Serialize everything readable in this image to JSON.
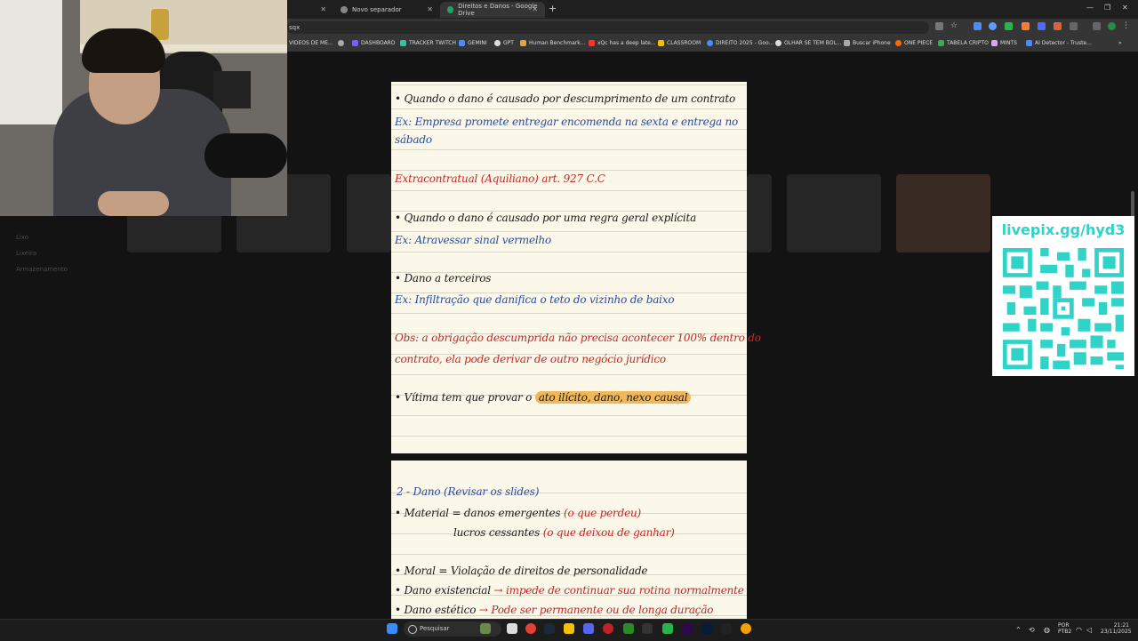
{
  "browser": {
    "tabs": [
      {
        "label": "",
        "active": false
      },
      {
        "label": "Novo separador",
        "active": false
      },
      {
        "label": "Direitos e Danos - Google Drive",
        "active": true
      }
    ],
    "address": "sqx",
    "bookmarks": [
      {
        "label": "VIDEOS DE ME...",
        "color": "#888888"
      },
      {
        "label": "DASHBOARD",
        "color": "#7b5cff"
      },
      {
        "label": "TRACKER TWITCH",
        "color": "#3ac0a0"
      },
      {
        "label": "GEMINI",
        "color": "#4a8cff"
      },
      {
        "label": "GPT",
        "color": "#dddddd"
      },
      {
        "label": "Human Benchmark...",
        "color": "#e6a23c"
      },
      {
        "label": "xQc has a deep late...",
        "color": "#ff3333"
      },
      {
        "label": "CLASSROOM",
        "color": "#f2c200"
      },
      {
        "label": "DIREITO 2025 - Goo...",
        "color": "#4a8cff"
      },
      {
        "label": "OLHAR SE TEM BOL...",
        "color": "#dddddd"
      },
      {
        "label": "Buscar iPhone",
        "color": "#aaaaaa"
      },
      {
        "label": "ONE PIECE",
        "color": "#ff6a00"
      },
      {
        "label": "TABELA CRIPTO",
        "color": "#2ab34a"
      },
      {
        "label": "MINTS",
        "color": "#e0a0ff"
      },
      {
        "label": "AI Detector - Truste...",
        "color": "#4a8cff"
      }
    ]
  },
  "drive": {
    "sidebar": [
      "Lixo",
      "Lixeira",
      "Armazenamento"
    ]
  },
  "notes": {
    "page1": [
      {
        "text": "• Quando o dano é causado por descumprimento de um contrato",
        "color": "black"
      },
      {
        "text": "Ex: Empresa promete entregar encomenda na sexta e entrega no",
        "color": "blue"
      },
      {
        "text": "sábado",
        "color": "blue"
      },
      {
        "text": "Extracontratual (Aquiliano) art. 927 C.C",
        "color": "red"
      },
      {
        "text": "• Quando o dano é causado por uma regra geral explícita",
        "color": "black"
      },
      {
        "text": "Ex: Atravessar sinal vermelho",
        "color": "blue"
      },
      {
        "text": "• Dano a terceiros",
        "color": "black"
      },
      {
        "text": "Ex: Infiltração que danifica o teto do vizinho de baixo",
        "color": "blue"
      },
      {
        "text": "Obs: a obrigação descumprida não precisa acontecer 100% dentro do",
        "color": "red"
      },
      {
        "text": "contrato, ela pode derivar de outro negócio jurídico",
        "color": "red"
      },
      {
        "text": "• Vítima tem que provar o",
        "color": "black"
      },
      {
        "text": "ato ilícito, dano, nexo causal",
        "color": "highlight"
      }
    ],
    "page2": [
      {
        "text": "2 - Dano (Revisar os slides)",
        "color": "blue"
      },
      {
        "text": "• Material = danos emergentes",
        "color": "black"
      },
      {
        "text": "(o que perdeu)",
        "color": "red"
      },
      {
        "text": "lucros cessantes",
        "color": "black"
      },
      {
        "text": "(o que deixou de ganhar)",
        "color": "red"
      },
      {
        "text": "• Moral = Violação de direitos de personalidade",
        "color": "black"
      },
      {
        "text": "• Dano existencial",
        "color": "black"
      },
      {
        "text": "→ impede de continuar sua rotina normalmente",
        "color": "red"
      },
      {
        "text": "• Dano estético",
        "color": "black"
      },
      {
        "text": "→ Pode ser permanente ou de longa duração",
        "color": "red"
      }
    ]
  },
  "overlay": {
    "qr_label": "livepix.gg/hyd3"
  },
  "taskbar": {
    "search_placeholder": "Pesquisar",
    "lang_top": "POR",
    "lang_bottom": "PTB2",
    "time": "21:21",
    "date": "23/11/2025"
  }
}
